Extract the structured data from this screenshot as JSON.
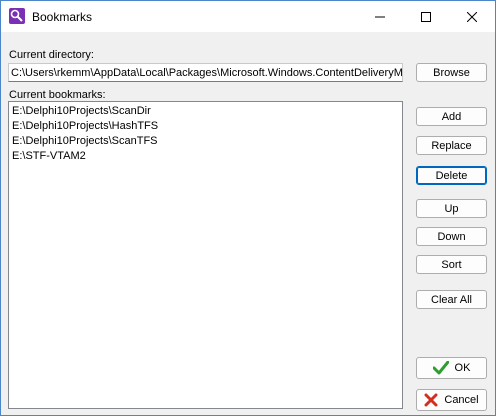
{
  "window": {
    "title": "Bookmarks",
    "accent": "#0067c0",
    "icon_name": "bookmarks-app-icon"
  },
  "directory": {
    "label": "Current directory:",
    "value": "C:\\Users\\rkemm\\AppData\\Local\\Packages\\Microsoft.Windows.ContentDeliveryManager"
  },
  "bookmarks": {
    "label": "Current bookmarks:",
    "items": [
      "E:\\Delphi10Projects\\ScanDir",
      "E:\\Delphi10Projects\\HashTFS",
      "E:\\Delphi10Projects\\ScanTFS",
      "E:\\STF-VTAM2"
    ]
  },
  "buttons": {
    "browse": "Browse",
    "add": "Add",
    "replace": "Replace",
    "delete": "Delete",
    "up": "Up",
    "down": "Down",
    "sort": "Sort",
    "clear_all": "Clear All",
    "ok": "OK",
    "cancel": "Cancel"
  },
  "colors": {
    "ok_check": "#2e9e2e",
    "cancel_x": "#d03020"
  }
}
